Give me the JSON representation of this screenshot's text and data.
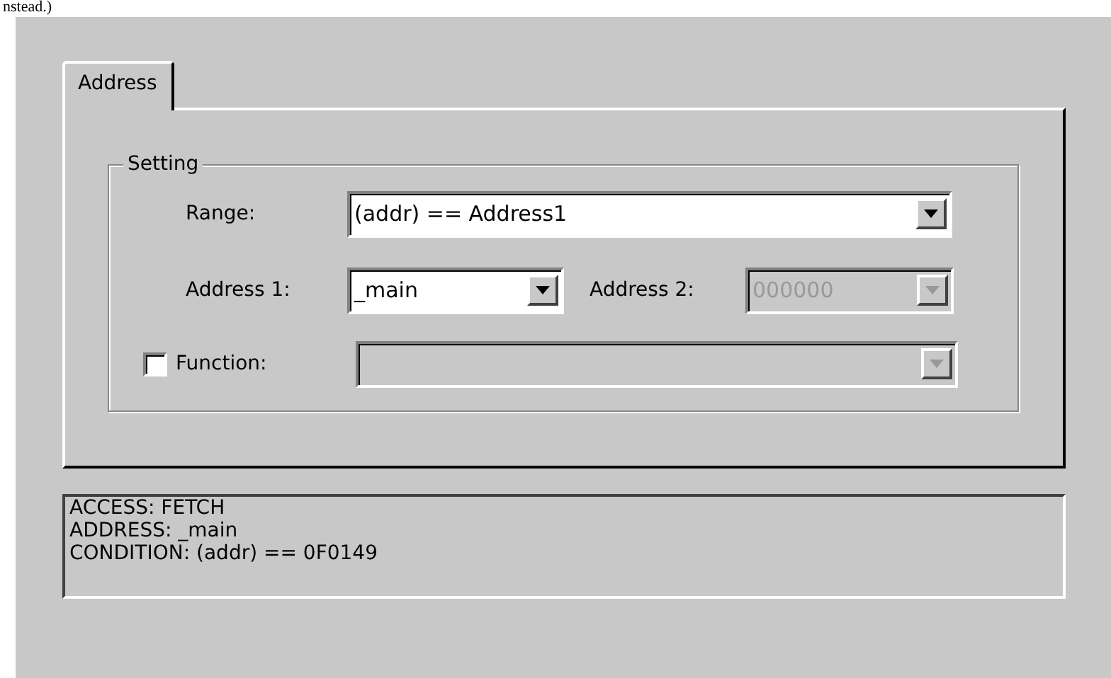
{
  "header_fragment": "nstead.)",
  "tabs": [
    {
      "label": "Address",
      "selected": true
    }
  ],
  "group": {
    "title": "Setting",
    "range": {
      "label": "Range:",
      "value": "(addr) == Address1",
      "disabled": false
    },
    "address_1": {
      "label": "Address 1:",
      "value": "_main",
      "disabled": false
    },
    "address_2": {
      "label": "Address 2:",
      "value": "000000",
      "disabled": true
    },
    "function": {
      "label": "Function:",
      "checked": false,
      "disabled": true
    }
  },
  "summary": [
    "ACCESS: FETCH",
    "ADDRESS: _main",
    "CONDITION: (addr) == 0F0149"
  ]
}
